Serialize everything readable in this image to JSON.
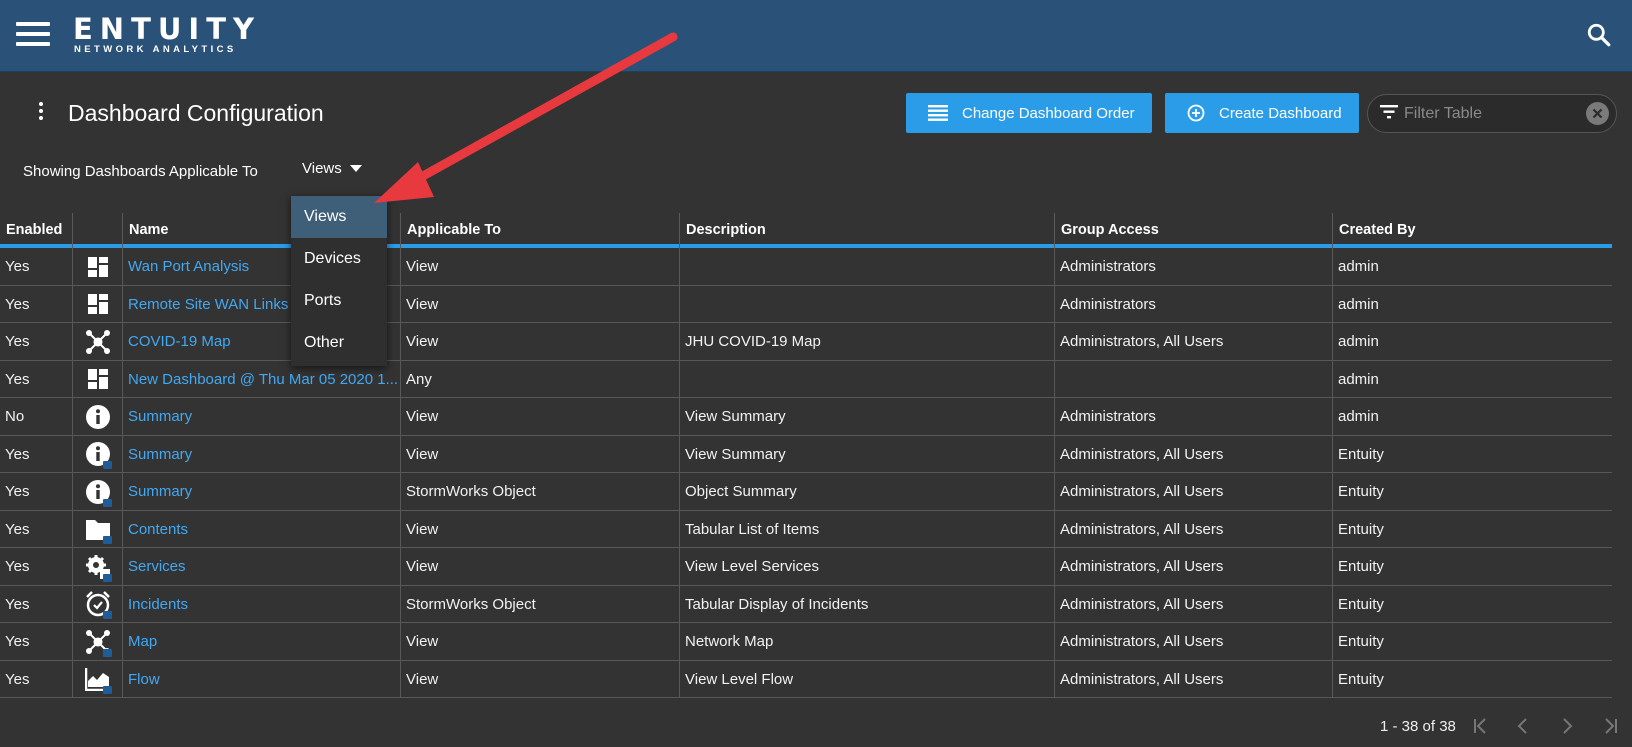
{
  "header": {
    "brand": "ENTUITY",
    "brand_sub": "NETWORK ANALYTICS",
    "menu_icon": "hamburger-menu-icon",
    "search_icon": "search-icon",
    "bg_color": "#2a5278"
  },
  "page": {
    "title": "Dashboard Configuration",
    "change_order_label": "Change Dashboard Order",
    "create_label": "Create Dashboard",
    "filter_placeholder": "Filter Table",
    "showing_label": "Showing Dashboards Applicable To",
    "applicable_selected": "Views",
    "accent": "#2b9de8",
    "link_color": "#42a8f2"
  },
  "dropdown": {
    "options": [
      "Views",
      "Devices",
      "Ports",
      "Other"
    ],
    "active": "Views"
  },
  "table": {
    "columns": [
      "Enabled",
      "",
      "Name",
      "Applicable To",
      "Description",
      "Group Access",
      "Created By"
    ],
    "rows": [
      {
        "enabled": "Yes",
        "icon": "dashboard-grid-icon",
        "locked": false,
        "name": "Wan Port Analysis",
        "applicable": "View",
        "description": "",
        "group": "Administrators",
        "created": "admin"
      },
      {
        "enabled": "Yes",
        "icon": "dashboard-grid-icon",
        "locked": false,
        "name": "Remote Site WAN Links",
        "applicable": "View",
        "description": "",
        "group": "Administrators",
        "created": "admin"
      },
      {
        "enabled": "Yes",
        "icon": "network-map-icon",
        "locked": false,
        "name": "COVID-19 Map",
        "applicable": "View",
        "description": "JHU COVID-19 Map",
        "group": "Administrators, All Users",
        "created": "admin"
      },
      {
        "enabled": "Yes",
        "icon": "dashboard-grid-icon",
        "locked": false,
        "name": "New Dashboard @ Thu Mar 05 2020 1...",
        "applicable": "Any",
        "description": "",
        "group": "",
        "created": "admin"
      },
      {
        "enabled": "No",
        "icon": "info-icon",
        "locked": false,
        "name": "Summary",
        "applicable": "View",
        "description": "View Summary",
        "group": "Administrators",
        "created": "admin"
      },
      {
        "enabled": "Yes",
        "icon": "info-icon",
        "locked": true,
        "name": "Summary",
        "applicable": "View",
        "description": "View Summary",
        "group": "Administrators, All Users",
        "created": "Entuity"
      },
      {
        "enabled": "Yes",
        "icon": "info-icon",
        "locked": true,
        "name": "Summary",
        "applicable": "StormWorks Object",
        "description": "Object Summary",
        "group": "Administrators, All Users",
        "created": "Entuity"
      },
      {
        "enabled": "Yes",
        "icon": "folder-icon",
        "locked": true,
        "name": "Contents",
        "applicable": "View",
        "description": "Tabular List of Items",
        "group": "Administrators, All Users",
        "created": "Entuity"
      },
      {
        "enabled": "Yes",
        "icon": "services-gear-icon",
        "locked": true,
        "name": "Services",
        "applicable": "View",
        "description": "View Level Services",
        "group": "Administrators, All Users",
        "created": "Entuity"
      },
      {
        "enabled": "Yes",
        "icon": "alarm-clock-icon",
        "locked": true,
        "name": "Incidents",
        "applicable": "StormWorks Object",
        "description": "Tabular Display of Incidents",
        "group": "Administrators, All Users",
        "created": "Entuity"
      },
      {
        "enabled": "Yes",
        "icon": "network-map-icon",
        "locked": true,
        "name": "Map",
        "applicable": "View",
        "description": "Network Map",
        "group": "Administrators, All Users",
        "created": "Entuity"
      },
      {
        "enabled": "Yes",
        "icon": "flow-chart-icon",
        "locked": true,
        "name": "Flow",
        "applicable": "View",
        "description": "View Level Flow",
        "group": "Administrators, All Users",
        "created": "Entuity"
      }
    ]
  },
  "pagination": {
    "label": "1 - 38 of 38"
  }
}
